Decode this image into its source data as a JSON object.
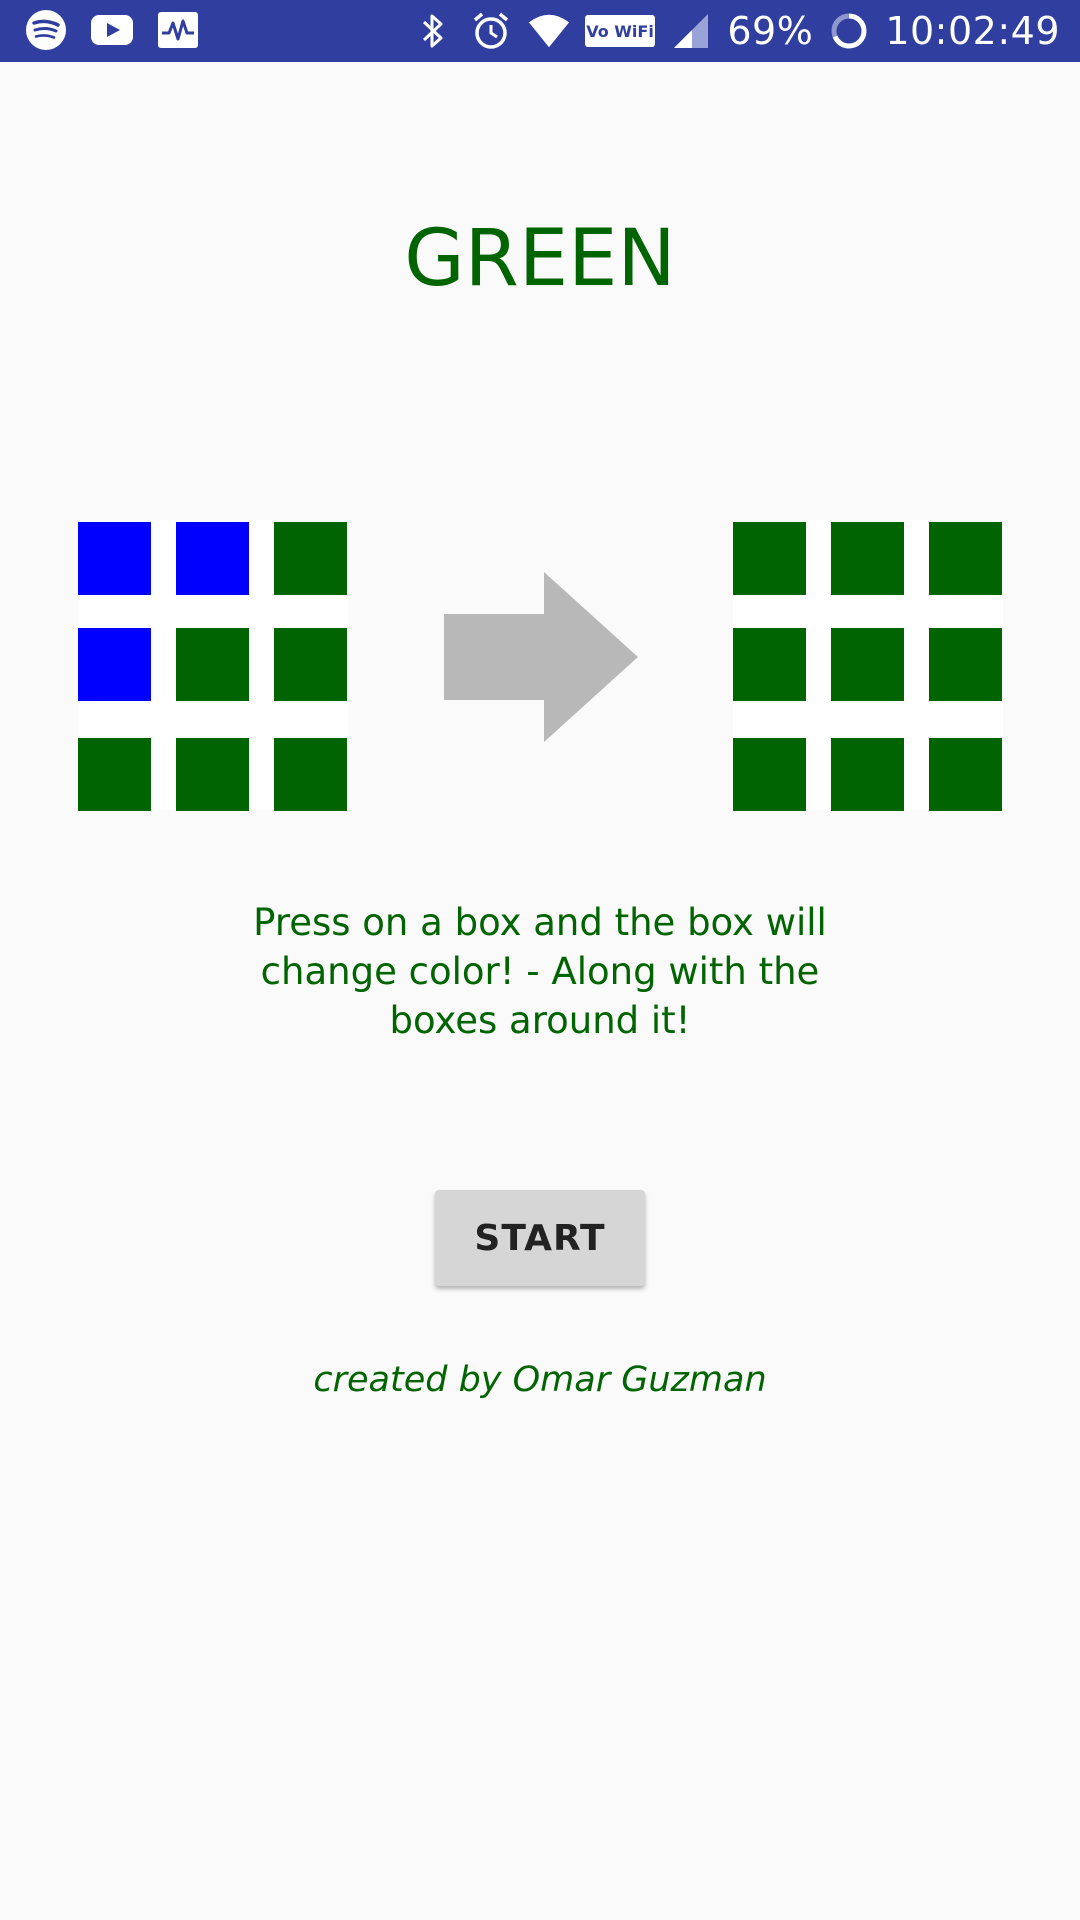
{
  "status_bar": {
    "battery": "69%",
    "time": "10:02:49",
    "wifi_badge": "Vo WiFi",
    "left_icons": [
      "spotify-icon",
      "youtube-icon",
      "activity-icon"
    ],
    "right_icons": [
      "bluetooth-icon",
      "alarm-icon",
      "wifi-icon",
      "vowifi-icon",
      "signal-icon",
      "battery-icon"
    ]
  },
  "title": "GREEN",
  "colors": {
    "green": "#006400",
    "blue": "#0000ff",
    "arrow": "#b8b8b8",
    "status_bar": "#303f9f",
    "button": "#d6d6d6"
  },
  "demo": {
    "before_grid": [
      "blue",
      "blue",
      "green",
      "blue",
      "green",
      "green",
      "green",
      "green",
      "green"
    ],
    "after_grid": [
      "green",
      "green",
      "green",
      "green",
      "green",
      "green",
      "green",
      "green",
      "green"
    ]
  },
  "instructions": "Press on a box and the box will change color! - Along with the boxes around it!",
  "start_label": "START",
  "credit": "created by Omar Guzman"
}
